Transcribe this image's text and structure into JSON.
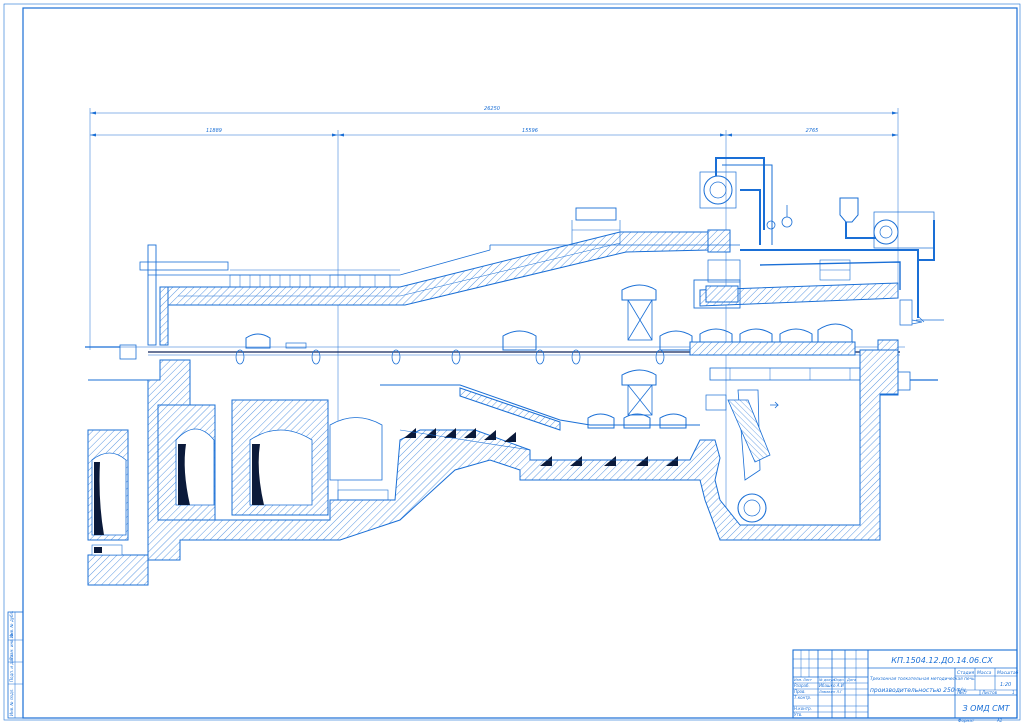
{
  "dimensions": {
    "overall": "26250",
    "section_1": "11889",
    "section_2": "15596",
    "section_3": "2765"
  },
  "title_block": {
    "designation": "КП.1504.12.ДО.14.06.СХ",
    "title_line1": "Трехзонная толкательная методическая печь",
    "title_line2": "производительностью 250 т/ч",
    "stage_header": "Стадия",
    "mass_header": "Масса",
    "scale_header": "Масштаб",
    "scale_value": "1:20",
    "sheet_label": "Лист",
    "sheets_label": "Листов",
    "sheets_value": "1",
    "org": "З ОМД СМТ",
    "format_label": "Формат",
    "format_value": "А1",
    "col_headers": [
      "Изм.",
      "Лист",
      "№ докум.",
      "Подп.",
      "Дата"
    ],
    "roles": [
      {
        "role": "Разраб.",
        "name": "Ибашко А.И"
      },
      {
        "role": "Пров.",
        "name": "Ламакин Л.Г"
      },
      {
        "role": "Т.контр.",
        "name": ""
      },
      {
        "role": "Н.контр.",
        "name": ""
      },
      {
        "role": "Утв.",
        "name": ""
      }
    ],
    "side_stamps": [
      "Инв. № подл.",
      "Подп. и дата",
      "Взам. инв. №",
      "Инв. № дубл.",
      "Подп. и дата"
    ]
  },
  "colors": {
    "line": "#1a6fd6",
    "dark_fill": "#0b1a3a"
  }
}
